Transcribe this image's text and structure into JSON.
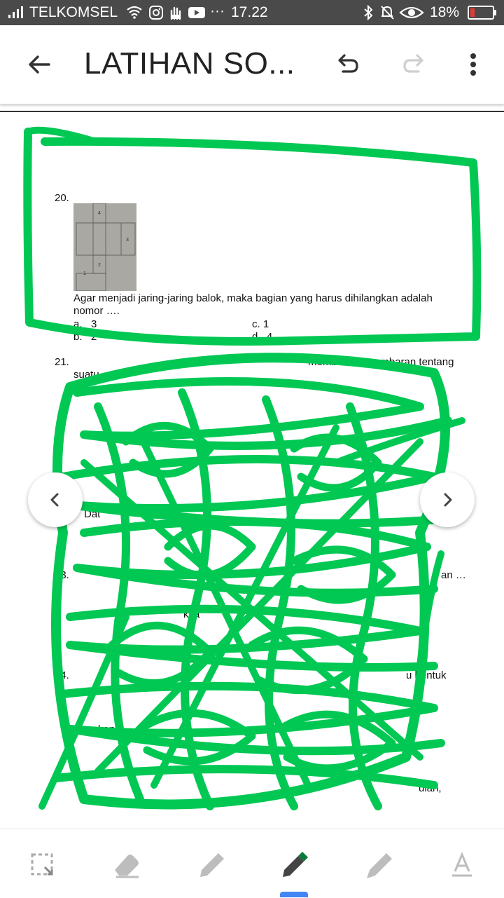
{
  "status_bar": {
    "carrier": "TELKOMSEL",
    "time": "17.22",
    "battery": "18%",
    "icons": [
      "signal-icon",
      "wifi-icon",
      "instagram-icon",
      "hand-icon",
      "youtube-icon",
      "more-dots-icon",
      "bluetooth-icon",
      "mute-icon",
      "eye-icon",
      "battery-icon"
    ]
  },
  "app_bar": {
    "title": "LATIHAN SO...",
    "back_icon": "back-arrow-icon",
    "undo_icon": "undo-icon",
    "redo_icon": "redo-icon",
    "menu_icon": "overflow-menu-icon"
  },
  "document": {
    "question20": {
      "number": "20.",
      "text_line1": "Agar menjadi jaring-jaring balok, maka bagian yang harus dihilangkan adalah",
      "text_line2": "nomor ….",
      "option_a": "a.   3",
      "option_b": "b.   2",
      "option_c": "c. 1",
      "option_d": "d . 4",
      "figure_labels": [
        "4",
        "3",
        "2",
        "1"
      ]
    },
    "partial_text": {
      "q21_start": "21.",
      "q21_fragment": "memberikan gambaran tentang",
      "q21_line2": "suatu",
      "da_fragment": "Dat",
      "q23_number": "23.",
      "q23_end": "an …",
      "q24_number": "24.",
      "q24_fragment": "u bentuk",
      "ksa_fragment": "ksa",
      "kang_fragment": "kang",
      "last_fragment": "ulan,"
    }
  },
  "navigation": {
    "prev_icon": "chevron-left-icon",
    "next_icon": "chevron-right-icon"
  },
  "toolbar": {
    "tools": [
      "selection-icon",
      "eraser-icon",
      "pen-icon",
      "marker-pen-icon",
      "highlighter-icon",
      "text-icon"
    ],
    "active_tool": "marker-pen-icon",
    "active_color": "#0b7a3b"
  },
  "colors": {
    "scribble": "#00c853",
    "status_bar_bg": "#4a4a4a",
    "accent": "#4285f4"
  }
}
